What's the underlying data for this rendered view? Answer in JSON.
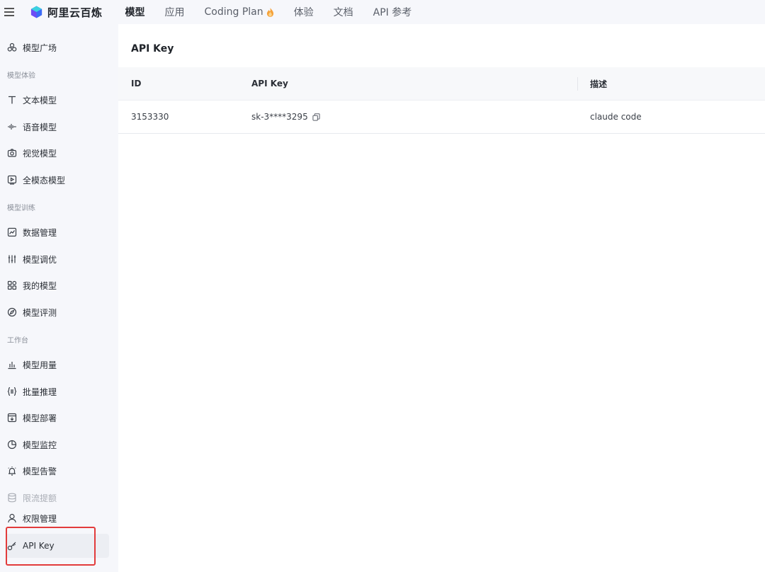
{
  "brand": {
    "name": "阿里云百炼"
  },
  "topnav": {
    "items": [
      {
        "label": "模型",
        "active": true
      },
      {
        "label": "应用",
        "active": false
      },
      {
        "label": "Coding Plan",
        "active": false
      },
      {
        "label": "体验",
        "active": false
      },
      {
        "label": "文档",
        "active": false
      },
      {
        "label": "API 参考",
        "active": false
      }
    ]
  },
  "sidebar": {
    "top_item": {
      "label": "模型广场",
      "icon": "cluster-icon"
    },
    "groups": [
      {
        "title": "模型体验",
        "items": [
          {
            "label": "文本模型",
            "icon": "text-icon"
          },
          {
            "label": "语音模型",
            "icon": "waveform-icon"
          },
          {
            "label": "视觉模型",
            "icon": "camera-icon"
          },
          {
            "label": "全模态模型",
            "icon": "play-box-icon"
          }
        ]
      },
      {
        "title": "模型训练",
        "items": [
          {
            "label": "数据管理",
            "icon": "line-chart-icon"
          },
          {
            "label": "模型调优",
            "icon": "sliders-icon"
          },
          {
            "label": "我的模型",
            "icon": "apps-icon"
          },
          {
            "label": "模型评测",
            "icon": "compass-icon"
          }
        ]
      },
      {
        "title": "工作台",
        "items": [
          {
            "label": "模型用量",
            "icon": "bar-chart-icon"
          },
          {
            "label": "批量推理",
            "icon": "braces-icon"
          },
          {
            "label": "模型部署",
            "icon": "download-box-icon"
          },
          {
            "label": "模型监控",
            "icon": "pie-icon"
          },
          {
            "label": "模型告警",
            "icon": "alarm-icon"
          },
          {
            "label": "限流提额",
            "icon": "database-icon"
          },
          {
            "label": "权限管理",
            "icon": "user-icon"
          },
          {
            "label": "API Key",
            "icon": "key-icon"
          }
        ]
      }
    ]
  },
  "main": {
    "title": "API Key",
    "table": {
      "headers": [
        "ID",
        "API Key",
        "描述"
      ],
      "rows": [
        {
          "id": "3153330",
          "api_key": "sk-3****3295",
          "description": "claude code"
        }
      ]
    }
  },
  "colors": {
    "highlight_border": "#e23b3b",
    "page_bg": "#f6f7fb",
    "content_bg": "#ffffff"
  }
}
